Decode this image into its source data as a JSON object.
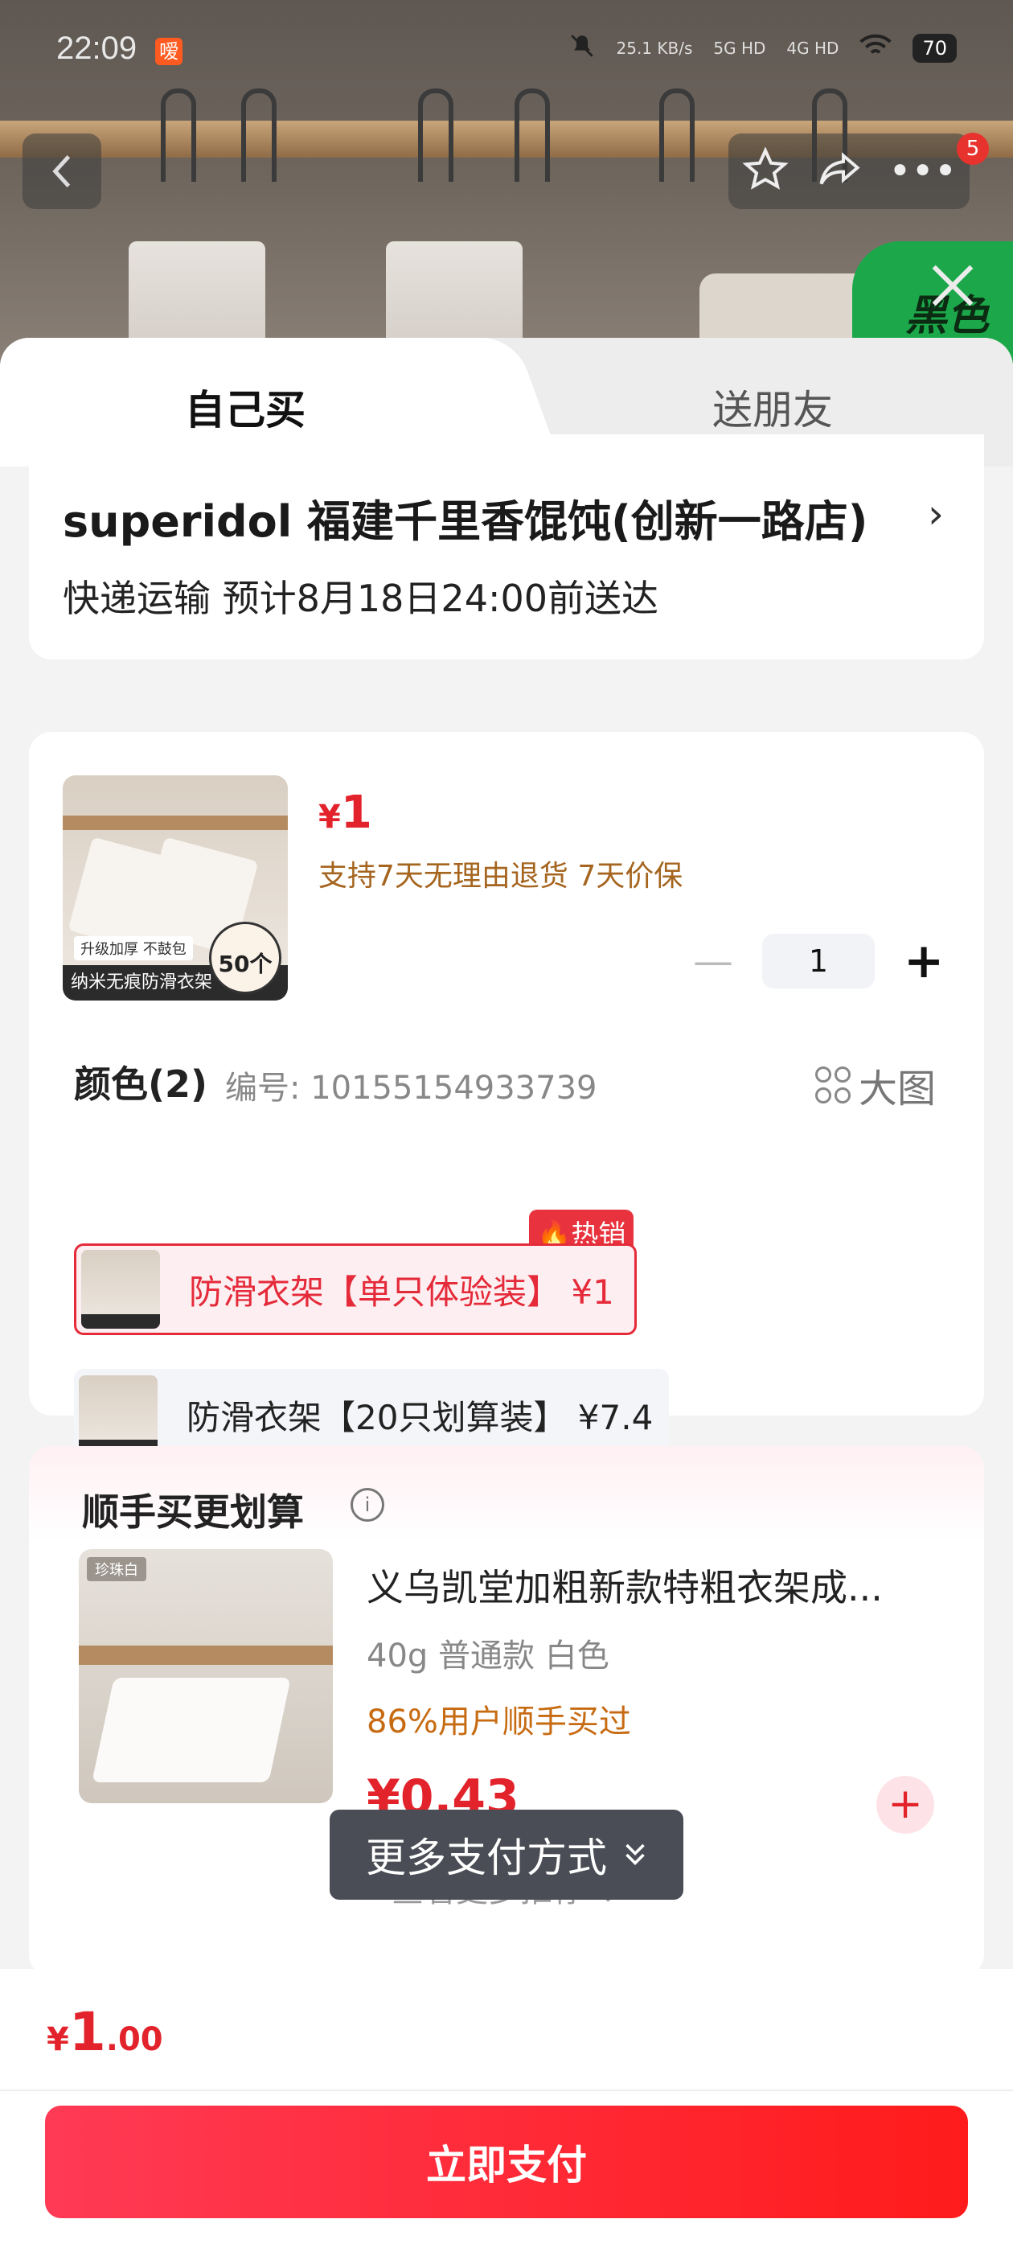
{
  "status_bar": {
    "time": "22:09",
    "app_badge": "嗳",
    "net_speed": "25.1 KB/s",
    "signal_1": "5G HD",
    "signal_2": "4G HD",
    "battery": "70"
  },
  "top_bar": {
    "notification_count": "5"
  },
  "hero": {
    "promo_text": "黑色"
  },
  "tabs": {
    "self_buy": "自己买",
    "gift": "送朋友"
  },
  "store": {
    "name": "superidol  福建千里香馄饨(创新一路店)",
    "delivery": "快递运输 预计8月18日24:00前送达"
  },
  "product": {
    "thumb_banner": "纳米无痕防滑衣架",
    "thumb_tag": "升级加厚 不鼓包",
    "thumb_count": "50个",
    "price_symbol": "¥",
    "price": "1",
    "guarantee": "支持7天无理由退货  7天价保",
    "quantity": "1",
    "color_label": "颜色(2)",
    "sku_number": "编号: 10155154933739",
    "big_image_label": "大图",
    "options": [
      {
        "label": "防滑衣架【单只体验装】 ¥1",
        "selected": true,
        "badge": "热销"
      },
      {
        "label": "防滑衣架【20只划算装】 ¥7.4",
        "selected": false
      }
    ]
  },
  "addon": {
    "title": "顺手买更划算",
    "thumb_label": "珍珠白",
    "name": "义乌凯堂加粗新款特粗衣架成...",
    "spec": "40g 普通款 白色",
    "bought_note": "86%用户顺手买过",
    "price": "¥0.43",
    "more": "查看更多推荐"
  },
  "popup": {
    "more_payment": "更多支付方式"
  },
  "bottom": {
    "currency": "¥",
    "total_int": "1",
    "total_dec": ".00",
    "pay_button": "立即支付"
  },
  "colors": {
    "accent_red": "#e3232b",
    "pay_gradient_start": "#ff3a55",
    "pay_gradient_end": "#ff1b1b",
    "note_orange": "#a5651f"
  }
}
